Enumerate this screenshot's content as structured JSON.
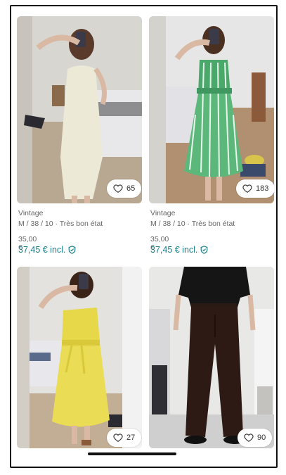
{
  "items": [
    {
      "brand": "Vintage",
      "details": "M / 38 / 10 · Très bon état",
      "price": "35,00 €",
      "price_incl": "37,45 € incl.",
      "favorites": "65",
      "photo": "woman-cream-knit-dress-mirror-selfie"
    },
    {
      "brand": "Vintage",
      "details": "M / 38 / 10 · Très bon état",
      "price": "35,00 €",
      "price_incl": "37,45 € incl.",
      "favorites": "183",
      "photo": "woman-green-striped-dress-mirror-selfie"
    },
    {
      "favorites": "27",
      "photo": "woman-yellow-dress-mirror-selfie"
    },
    {
      "favorites": "90",
      "photo": "person-brown-wide-trousers"
    }
  ],
  "icons": {
    "favorite": "heart-icon",
    "buyer_protection": "shield-check-icon"
  },
  "colors": {
    "accent": "#1a7f8a"
  }
}
